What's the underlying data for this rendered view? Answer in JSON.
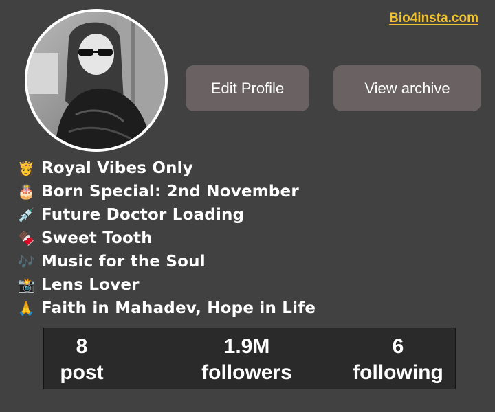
{
  "watermark": "Bio4insta.com",
  "profile": {
    "avatar_alt": "profile-photo"
  },
  "actions": {
    "edit_label": "Edit Profile",
    "archive_label": "View archive"
  },
  "bio": {
    "lines": [
      {
        "emoji": "👸",
        "text": "Royal Vibes Only"
      },
      {
        "emoji": "🎂",
        "text": "Born Special: 2nd November"
      },
      {
        "emoji": "💉",
        "text": "Future Doctor Loading"
      },
      {
        "emoji": "🍫",
        "text": "Sweet Tooth"
      },
      {
        "emoji": "🎶",
        "text": "Music for the Soul"
      },
      {
        "emoji": "📸",
        "text": "Lens Lover"
      },
      {
        "emoji": "🙏",
        "text": "Faith in Mahadev, Hope in Life"
      }
    ]
  },
  "stats": {
    "posts": {
      "value": "8",
      "label": "post"
    },
    "followers": {
      "value": "1.9M",
      "label": "followers"
    },
    "following": {
      "value": "6",
      "label": "following"
    }
  },
  "colors": {
    "background": "#414141",
    "button": "#6a6262",
    "stats_box": "#2a2a2a",
    "watermark": "#f2c230"
  }
}
